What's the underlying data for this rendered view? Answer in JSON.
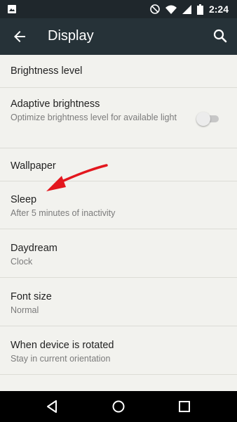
{
  "status_bar": {
    "time": "2:24",
    "icons": [
      "image-notification-icon",
      "do-not-disturb-icon",
      "wifi-icon",
      "signal-icon",
      "battery-icon"
    ]
  },
  "app_bar": {
    "title": "Display",
    "back_icon": "arrow-back-icon",
    "search_icon": "search-icon"
  },
  "settings": {
    "brightness": {
      "title": "Brightness level"
    },
    "adaptive": {
      "title": "Adaptive brightness",
      "subtitle": "Optimize brightness level for available light",
      "enabled": false
    },
    "wallpaper": {
      "title": "Wallpaper"
    },
    "sleep": {
      "title": "Sleep",
      "subtitle": "After 5 minutes of inactivity"
    },
    "daydream": {
      "title": "Daydream",
      "subtitle": "Clock"
    },
    "font_size": {
      "title": "Font size",
      "subtitle": "Normal"
    },
    "rotation": {
      "title": "When device is rotated",
      "subtitle": "Stay in current orientation"
    }
  },
  "annotation": {
    "arrow_color": "#e3171e"
  },
  "nav_bar": {
    "icons": [
      "nav-back-icon",
      "nav-home-icon",
      "nav-recents-icon"
    ]
  },
  "colors": {
    "app_bar": "#263238",
    "status_bar": "#1f272c",
    "background": "#f2f2ee",
    "nav_bar": "#000000"
  }
}
